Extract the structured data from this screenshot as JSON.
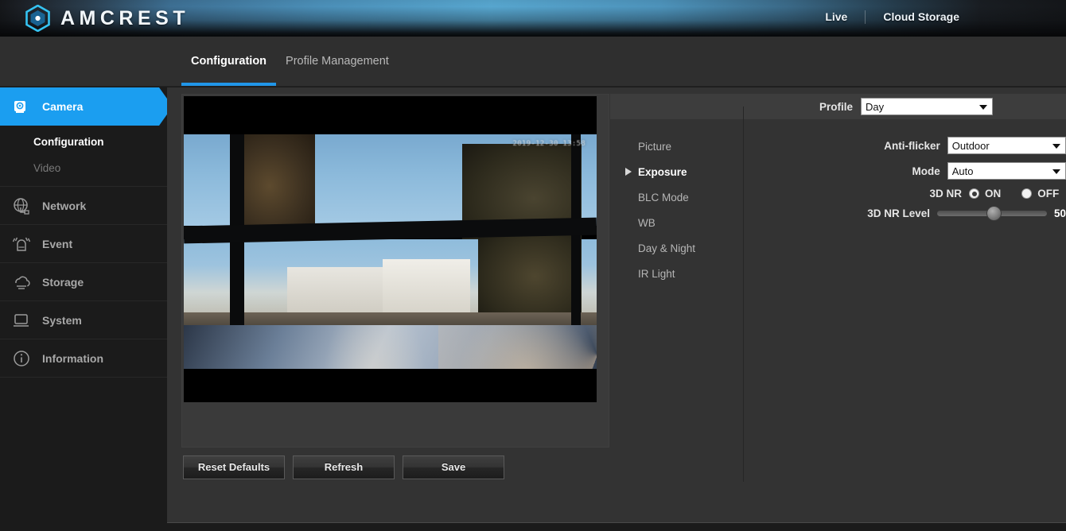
{
  "header": {
    "brand": "AMCREST",
    "logo_icon": "amcrest-hexagon-logo",
    "links": [
      {
        "label": "Live",
        "name": "live-link"
      },
      {
        "label": "Cloud Storage",
        "name": "cloud-storage-link"
      }
    ]
  },
  "tabs": [
    {
      "label": "Configuration",
      "active": true
    },
    {
      "label": "Profile Management",
      "active": false
    }
  ],
  "sidebar": {
    "items": [
      {
        "label": "Camera",
        "icon": "camera-icon",
        "active": true
      },
      {
        "label": "Network",
        "icon": "network-globe-icon",
        "active": false
      },
      {
        "label": "Event",
        "icon": "event-bell-icon",
        "active": false
      },
      {
        "label": "Storage",
        "icon": "storage-cloud-icon",
        "active": false
      },
      {
        "label": "System",
        "icon": "system-monitor-icon",
        "active": false
      },
      {
        "label": "Information",
        "icon": "information-circle-icon",
        "active": false
      }
    ],
    "sub_items": [
      {
        "label": "Configuration",
        "current": true
      },
      {
        "label": "Video",
        "current": false
      }
    ]
  },
  "video": {
    "timestamp_overlay": "2019-12-30 13:58",
    "name": "camera-live-preview"
  },
  "buttons": [
    {
      "label": "Reset Defaults",
      "name": "reset-defaults-button"
    },
    {
      "label": "Refresh",
      "name": "refresh-button"
    },
    {
      "label": "Save",
      "name": "save-button"
    }
  ],
  "subnav": [
    {
      "label": "Picture",
      "current": false
    },
    {
      "label": "Exposure",
      "current": true
    },
    {
      "label": "BLC Mode",
      "current": false
    },
    {
      "label": "WB",
      "current": false
    },
    {
      "label": "Day & Night",
      "current": false
    },
    {
      "label": "IR Light",
      "current": false
    }
  ],
  "form": {
    "profile": {
      "label": "Profile",
      "value": "Day"
    },
    "anti_flicker": {
      "label": "Anti-flicker",
      "value": "Outdoor"
    },
    "mode": {
      "label": "Mode",
      "value": "Auto"
    },
    "nr3d": {
      "label": "3D NR",
      "on_label": "ON",
      "off_label": "OFF",
      "selected": "ON"
    },
    "nr3d_level": {
      "label": "3D NR Level",
      "value": "50",
      "min": 0,
      "max": 100
    }
  },
  "colors": {
    "accent_blue": "#1b9ef0",
    "tab_underline": "#2196e8",
    "panel_bg": "#333333",
    "sidebar_bg": "#1b1b1b"
  }
}
